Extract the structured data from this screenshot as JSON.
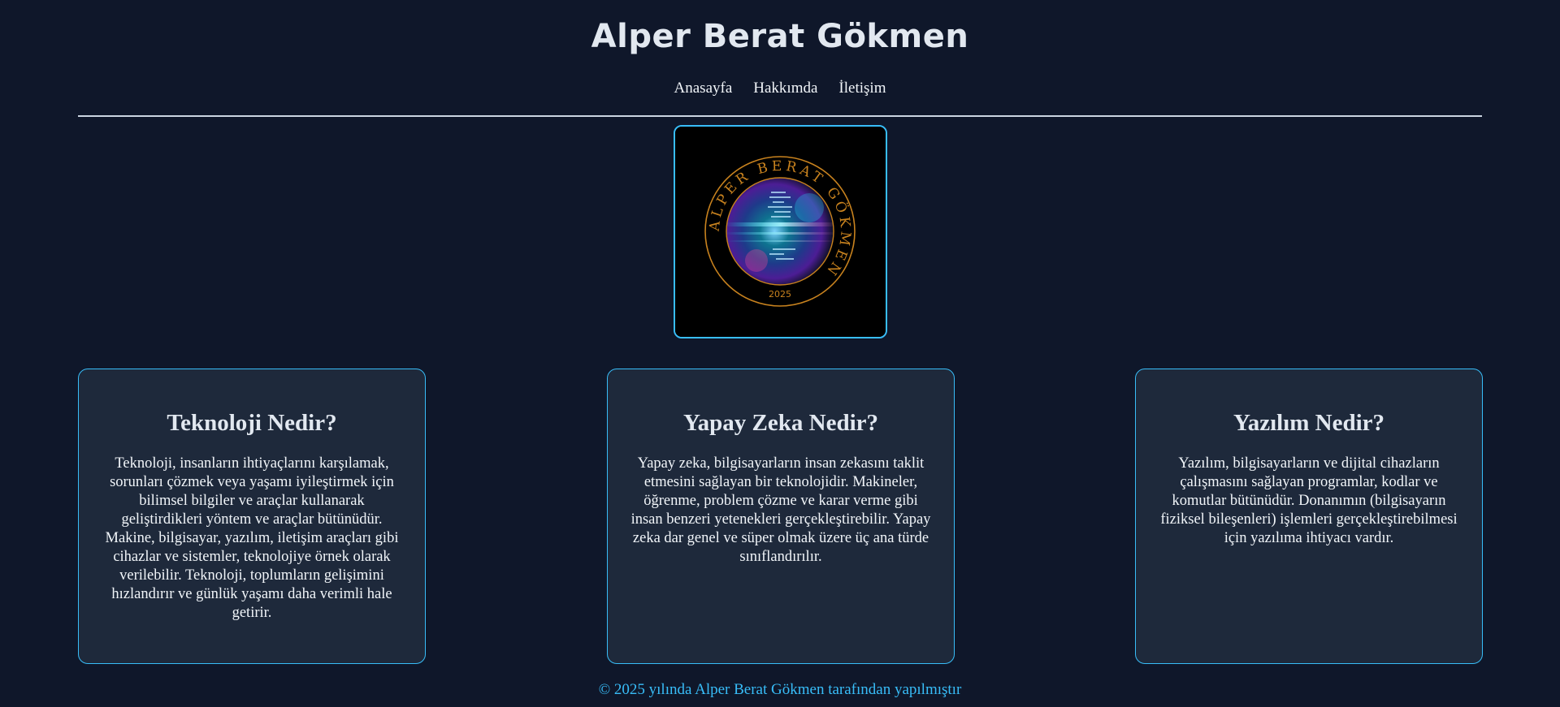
{
  "header": {
    "title": "Alper Berat Gökmen"
  },
  "nav": {
    "items": [
      {
        "label": "Anasayfa"
      },
      {
        "label": "Hakkımda"
      },
      {
        "label": "İletişim"
      }
    ]
  },
  "logo": {
    "ring_text": "ALPER BERAT GÖKMEN",
    "year": "2025",
    "accent_color": "#c8821e"
  },
  "cards": [
    {
      "title": "Teknoloji Nedir?",
      "body": "Teknoloji, insanların ihtiyaçlarını karşılamak, sorunları çözmek veya yaşamı iyileştirmek için bilimsel bilgiler ve araçlar kullanarak geliştirdikleri yöntem ve araçlar bütünüdür. Makine, bilgisayar, yazılım, iletişim araçları gibi cihazlar ve sistemler, teknolojiye örnek olarak verilebilir. Teknoloji, toplumların gelişimini hızlandırır ve günlük yaşamı daha verimli hale getirir."
    },
    {
      "title": "Yapay Zeka Nedir?",
      "body": "Yapay zeka, bilgisayarların insan zekasını taklit etmesini sağlayan bir teknolojidir. Makineler, öğrenme, problem çözme ve karar verme gibi insan benzeri yetenekleri gerçekleştirebilir. Yapay zeka dar genel ve süper olmak üzere üç ana türde sınıflandırılır."
    },
    {
      "title": "Yazılım Nedir?",
      "body": "Yazılım, bilgisayarların ve dijital cihazların çalışmasını sağlayan programlar, kodlar ve komutlar bütünüdür. Donanımın (bilgisayarın fiziksel bileşenleri) işlemleri gerçekleştirebilmesi için yazılıma ihtiyacı vardır."
    }
  ],
  "footer": {
    "text": "© 2025 yılında Alper Berat Gökmen tarafından yapılmıştır"
  },
  "colors": {
    "background": "#0f172a",
    "card_background": "#1e293b",
    "accent": "#38bdf8"
  }
}
